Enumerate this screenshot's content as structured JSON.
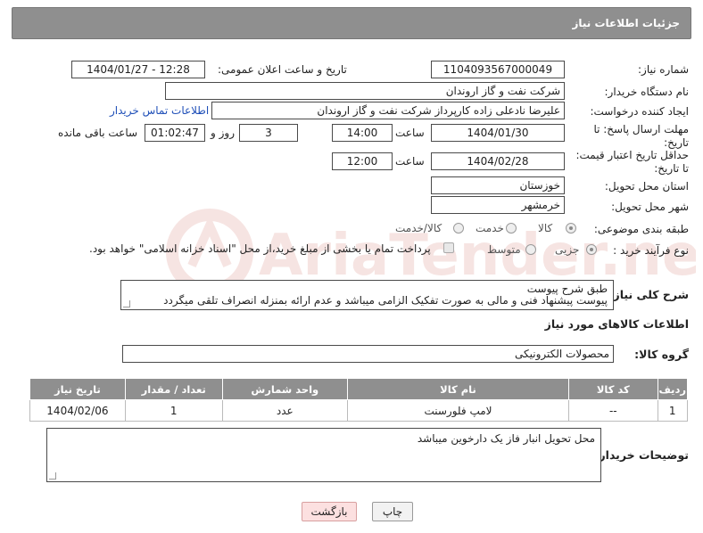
{
  "header": {
    "title": "جزئیات اطلاعات نیاز"
  },
  "form": {
    "need_number": {
      "label": "شماره نیاز:",
      "value": "1104093567000049"
    },
    "announce_datetime": {
      "label": "تاریخ و ساعت اعلان عمومی:",
      "value": "1404/01/27 - 12:28"
    },
    "buyer_org": {
      "label": "نام دستگاه خریدار:",
      "value": "شرکت نفت و گاز اروندان"
    },
    "requester": {
      "label": "ایجاد کننده درخواست:",
      "value": "علیرضا نادعلی زاده کارپرداز شرکت نفت و گاز اروندان",
      "contact_link": "اطلاعات تماس خریدار"
    },
    "deadline": {
      "label_line1": "مهلت ارسال پاسخ: تا",
      "label_line2": "تاریخ:",
      "date": "1404/01/30",
      "time_label": "ساعت",
      "time": "14:00",
      "days": "3",
      "days_label": "روز و",
      "remaining": "01:02:47",
      "remaining_label": "ساعت باقی مانده"
    },
    "price_validity": {
      "label_line1": "حداقل تاریخ اعتبار قیمت:",
      "label_line2": "تا تاریخ:",
      "date": "1404/02/28",
      "time_label": "ساعت",
      "time": "12:00"
    },
    "delivery_province": {
      "label": "استان محل تحویل:",
      "value": "خوزستان"
    },
    "delivery_city": {
      "label": "شهر محل تحویل:",
      "value": "خرمشهر"
    },
    "category": {
      "label": "طبقه بندی موضوعی:",
      "options": [
        "کالا",
        "خدمت",
        "کالا/خدمت"
      ],
      "selected": "کالا"
    },
    "purchase_type": {
      "label": "نوع فرآیند خرید :",
      "options": [
        "جزیی",
        "متوسط"
      ],
      "selected": "جزیی",
      "payment_note": "پرداخت تمام یا بخشی از مبلغ خرید،از محل \"اسناد خزانه اسلامی\" خواهد بود."
    }
  },
  "description": {
    "label": "شرح کلی نیاز:",
    "line1": "طبق شرح پیوست",
    "line2": "پیوست پیشنهاد فنی و مالی به صورت تفکیک الزامی میباشد و عدم ارائه بمنزله انصراف تلقی میگردد"
  },
  "goods_section": {
    "title": "اطلاعات کالاهای مورد نیاز",
    "group_label": "گروه کالا:",
    "group_value": "محصولات الکترونیکی",
    "columns": [
      "ردیف",
      "کد کالا",
      "نام کالا",
      "واحد شمارش",
      "تعداد / مقدار",
      "تاریخ نیاز"
    ],
    "rows": [
      {
        "row": "1",
        "code": "--",
        "name": "لامپ فلورسنت",
        "unit": "عدد",
        "qty": "1",
        "date": "1404/02/06"
      }
    ]
  },
  "buyer_notes": {
    "label": "توضیحات خریدار:",
    "text": "محل تحویل انبار فاز یک دارخوین میباشد"
  },
  "buttons": {
    "print": "چاپ",
    "back": "بازگشت"
  },
  "watermark": {
    "text": "AriaTender.net"
  }
}
